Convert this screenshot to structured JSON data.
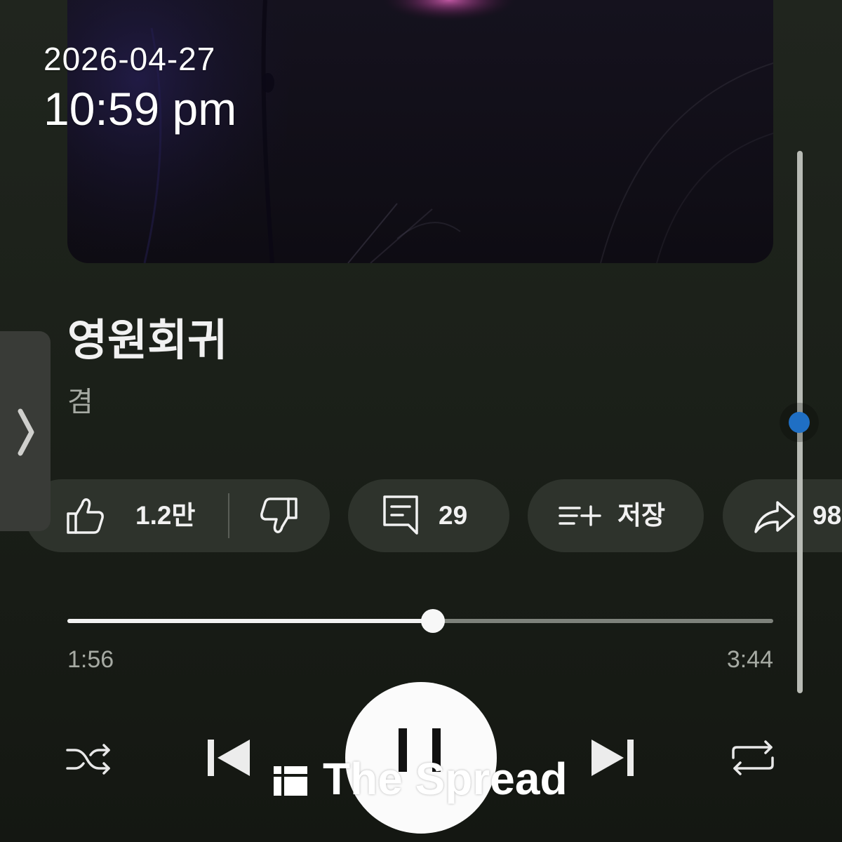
{
  "overlay": {
    "date": "2026-04-27",
    "time": "10:59 pm"
  },
  "track": {
    "title": "영원회귀",
    "artist": "겸"
  },
  "side_panel": {
    "icon": "chevron-right-icon"
  },
  "actions": {
    "like": {
      "icon": "thumbs-up-icon",
      "count": "1.2만"
    },
    "dislike": {
      "icon": "thumbs-down-icon"
    },
    "comments": {
      "icon": "comment-icon",
      "count": "29"
    },
    "save": {
      "icon": "playlist-add-icon",
      "label": "저장"
    },
    "share": {
      "icon": "share-icon",
      "count": "98"
    }
  },
  "progress": {
    "elapsed": "1:56",
    "duration": "3:44",
    "played_fraction": 0.518
  },
  "controls": {
    "shuffle": {
      "icon": "shuffle-icon"
    },
    "previous": {
      "icon": "skip-previous-icon"
    },
    "play_pause": {
      "icon": "pause-icon"
    },
    "next": {
      "icon": "skip-next-icon"
    },
    "repeat": {
      "icon": "repeat-icon"
    }
  },
  "watermark": {
    "text": "The Spread",
    "icon": "watermark-logo-icon"
  },
  "colors": {
    "background_top": "#20251e",
    "background_bottom": "#141712",
    "chip": "#2e332c",
    "text_primary": "#f1f1f1",
    "text_secondary": "#a6aaa3",
    "progress_played": "#f2f2f2",
    "progress_remaining": "#7e827b",
    "scrollbar": "#b8bbb5",
    "indicator_dot": "#1f6fc4",
    "side_tab": "#393b37"
  }
}
